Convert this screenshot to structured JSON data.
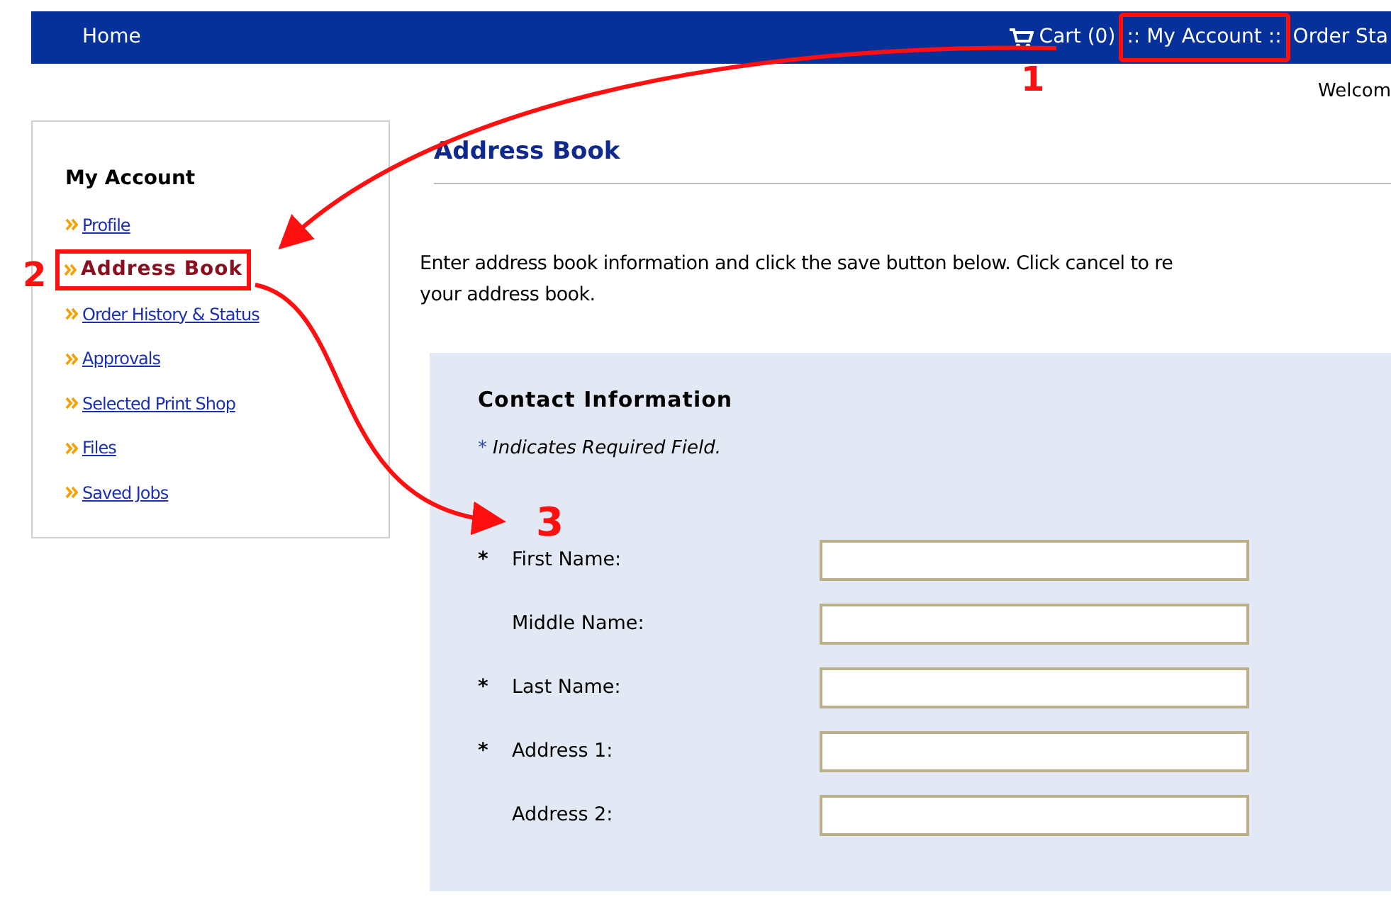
{
  "nav": {
    "home": "Home",
    "items": [
      {
        "kind": "cart",
        "label": "Cart (0)",
        "highlighted": false
      },
      {
        "kind": "link",
        "label": ":: My Account ::",
        "highlighted": true
      },
      {
        "kind": "link",
        "label": "Order Sta",
        "highlighted": false
      }
    ]
  },
  "welcome": "Welcom",
  "sidebar": {
    "title": "My Account",
    "items": [
      {
        "label": "Profile",
        "selected": false,
        "highlighted": false
      },
      {
        "label": "Address Book",
        "selected": true,
        "highlighted": true
      },
      {
        "label": "Order History & Status",
        "selected": false,
        "highlighted": false
      },
      {
        "label": "Approvals",
        "selected": false,
        "highlighted": false
      },
      {
        "label": "Selected Print Shop",
        "selected": false,
        "highlighted": false
      },
      {
        "label": "Files",
        "selected": false,
        "highlighted": false
      },
      {
        "label": "Saved Jobs",
        "selected": false,
        "highlighted": false
      }
    ]
  },
  "main": {
    "title": "Address Book",
    "intro": "Enter address book information and click the save button below. Click cancel to re",
    "intro_line2": "your address book."
  },
  "form": {
    "title": "Contact Information",
    "required_note": "Indicates Required Field.",
    "required_mark": "*",
    "fields": [
      {
        "label": "First Name:",
        "required": true
      },
      {
        "label": "Middle Name:",
        "required": false
      },
      {
        "label": "Last Name:",
        "required": true
      },
      {
        "label": "Address 1:",
        "required": true
      },
      {
        "label": "Address 2:",
        "required": false
      }
    ]
  },
  "annotations": {
    "steps": [
      "1",
      "2",
      "3"
    ]
  }
}
